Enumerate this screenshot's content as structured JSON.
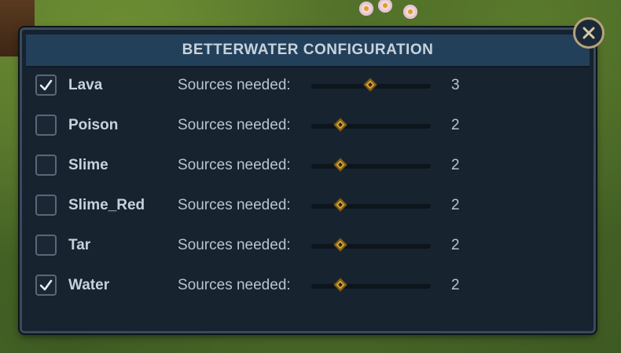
{
  "window": {
    "title": "BETTERWATER CONFIGURATION",
    "close_icon": "close-icon"
  },
  "colors": {
    "accent": "#d6a230",
    "panel": "#16222f",
    "header": "#23405a",
    "close_ring": "#b7a27b"
  },
  "slider": {
    "min": 1,
    "max": 5
  },
  "rows": [
    {
      "label": "Lava",
      "checked": true,
      "sources_label": "Sources needed:",
      "value": 3
    },
    {
      "label": "Poison",
      "checked": false,
      "sources_label": "Sources needed:",
      "value": 2
    },
    {
      "label": "Slime",
      "checked": false,
      "sources_label": "Sources needed:",
      "value": 2
    },
    {
      "label": "Slime_Red",
      "checked": false,
      "sources_label": "Sources needed:",
      "value": 2
    },
    {
      "label": "Tar",
      "checked": false,
      "sources_label": "Sources needed:",
      "value": 2
    },
    {
      "label": "Water",
      "checked": true,
      "sources_label": "Sources needed:",
      "value": 2
    }
  ]
}
